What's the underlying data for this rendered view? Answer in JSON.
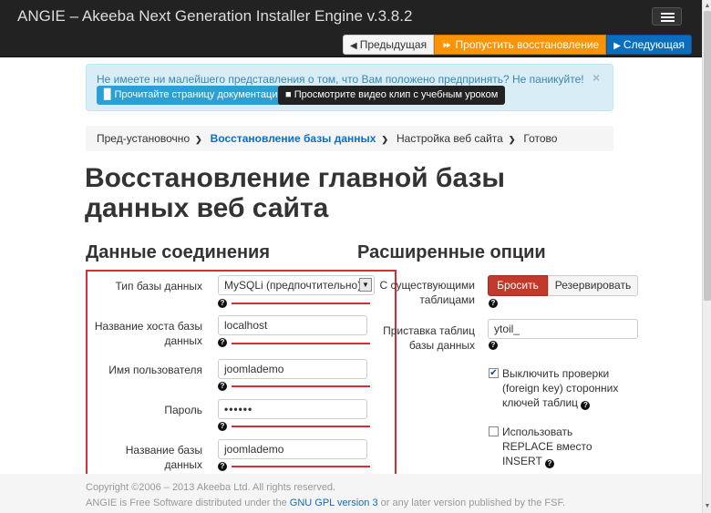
{
  "app": {
    "title": "ANGIE – Akeeba Next Generation Installer Engine v.3.8.2"
  },
  "nav": {
    "prev_label": "Предыдущая",
    "skip_label": "Пропустить восстановление",
    "next_label": "Следующая"
  },
  "alert": {
    "text": "Не имеете ни малейшего представления о том, что Вам положено предпринять? Не паникуйте!",
    "doc_button": "Прочитайте страницу документации",
    "video_button": "Просмотрите видео клип с учебным уроком",
    "close": "×"
  },
  "breadcrumb": {
    "items": [
      "Пред-установочно",
      "Восстановление базы данных",
      "Настройка веб сайта",
      "Готово"
    ]
  },
  "page_title": "Восстановление главной базы данных веб сайта",
  "connection": {
    "heading": "Данные соединения",
    "db_type_label": "Тип базы данных",
    "db_type_value": "MySQLi (предпочтительно)",
    "host_label": "Название хоста базы данных",
    "host_value": "localhost",
    "user_label": "Имя пользователя",
    "user_value": "joomlademo",
    "password_label": "Пароль",
    "password_value": "••••••",
    "dbname_label": "Название базы данных",
    "dbname_value": "joomlademo"
  },
  "advanced": {
    "heading": "Расширенные опции",
    "existing_tables_label": "С существующими таблицами",
    "drop_label": "Бросить",
    "backup_label": "Резервировать",
    "prefix_label": "Приставка таблиц базы данных",
    "prefix_value": "ytoil_",
    "fk_checkbox_label": "Выключить проверки (foreign key) сторонних ключей таблиц",
    "fk_checked": true,
    "replace_checkbox_label": "Использовать REPLACE вместо INSERT",
    "replace_checked": false
  },
  "footer": {
    "copyright": "Copyright ©2006 – 2013 Akeeba Ltd. All rights reserved.",
    "license_prefix": "ANGIE is Free Software distributed under the",
    "license_link": "GNU GPL version 3",
    "license_suffix": "or any later version published by the FSF."
  },
  "icons": {
    "prev": "arrow-left-icon",
    "skip": "fast-forward-icon",
    "next": "arrow-right-icon",
    "doc": "book-icon",
    "video": "video-icon",
    "help": "question-icon",
    "menu": "hamburger-icon"
  },
  "colors": {
    "navbar": "#222222",
    "skip_button": "#f89406",
    "next_button": "#0a6ebd",
    "drop_button": "#c0392b",
    "alert_bg": "#d9edf7",
    "annotation_red": "#d32f37"
  }
}
